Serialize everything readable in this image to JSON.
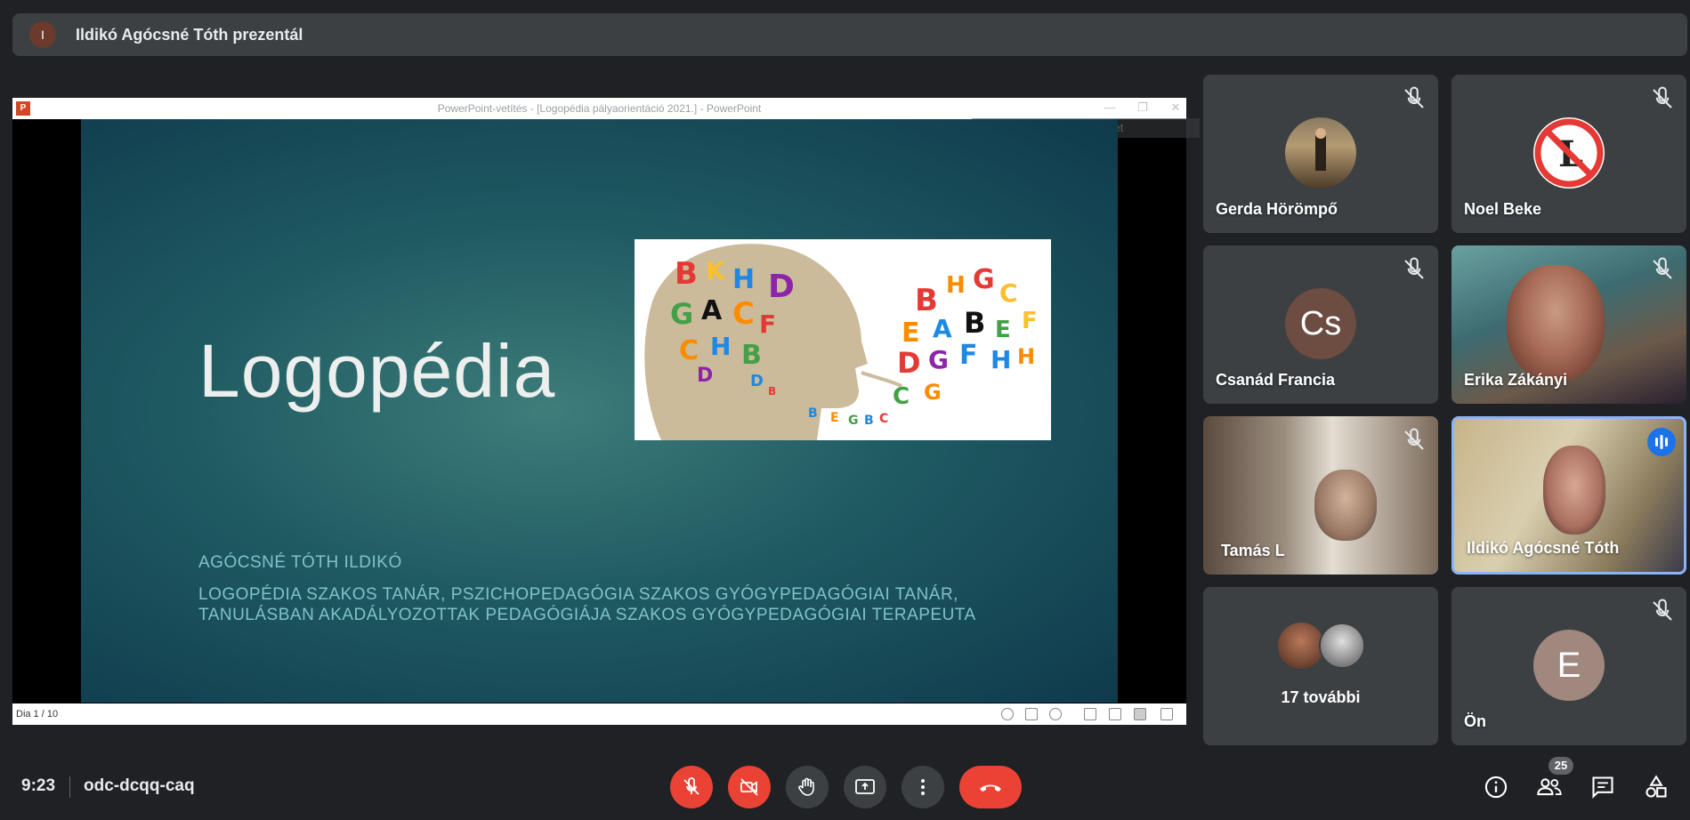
{
  "banner": {
    "avatar_letter": "I",
    "text": "Ildikó Agócsné Tóth prezentál"
  },
  "ppt": {
    "window_title": "PowerPoint-vetítés - [Logopédia pályaorientáció 2021.] - PowerPoint",
    "ghost_text": "Teljeslap alakú metszet",
    "slide_counter": "Dia 1 / 10"
  },
  "slide": {
    "title": "Logopédia",
    "author": "AGÓCSNÉ TÓTH ILDIKÓ",
    "role_line1": "LOGOPÉDIA SZAKOS TANÁR, PSZICHOPEDAGÓGIA SZAKOS GYÓGYPEDAGÓGIAI TANÁR,",
    "role_line2": "TANULÁSBAN AKADÁLYOZOTTAK PEDAGÓGIÁJA SZAKOS GYÓGYPEDAGÓGIAI TERAPEUTA"
  },
  "participants": {
    "gerda": {
      "name": "Gerda Hörömpő"
    },
    "noel": {
      "name": "Noel Beke"
    },
    "csanad": {
      "name": "Csanád Francia",
      "initials": "Cs"
    },
    "erika": {
      "name": "Erika Zákányi"
    },
    "tamas": {
      "name": "Tamás L"
    },
    "ildiko": {
      "name": "Ildikó Agócsné Tóth"
    },
    "more": {
      "label": "17 további"
    },
    "self": {
      "name": "Ön",
      "initial": "E"
    }
  },
  "bottom": {
    "time": "9:23",
    "meeting_code": "odc-dcqq-caq",
    "participant_count": "25"
  },
  "colors": {
    "end_call": "#ea4335",
    "speaking": "#1a73e8",
    "tile": "#3c4043"
  }
}
